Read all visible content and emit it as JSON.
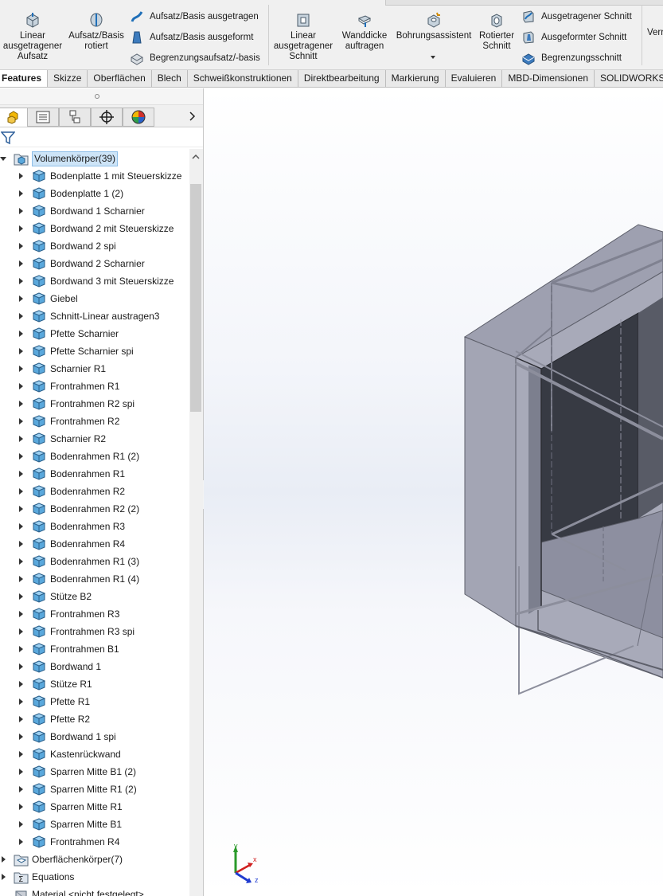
{
  "ribbon": {
    "linear_boss": "Linear ausgetragener Aufsatz",
    "revolved_boss": "Aufsatz/Basis rotiert",
    "swept_boss": "Aufsatz/Basis ausgetragen",
    "lofted_boss": "Aufsatz/Basis ausgeformt",
    "boundary_boss": "Begrenzungsaufsatz/-basis",
    "linear_cut": "Linear ausgetragener Schnitt",
    "thicken": "Wanddicke auftragen",
    "hole_wizard": "Bohrungsassistent",
    "revolved_cut": "Rotierter Schnitt",
    "swept_cut": "Ausgetragener Schnitt",
    "lofted_cut": "Ausgeformter Schnitt",
    "boundary_cut": "Begrenzungsschnitt",
    "more": "Verr"
  },
  "command_tabs": [
    "Features",
    "Skizze",
    "Oberflächen",
    "Blech",
    "Schweißkonstruktionen",
    "Direktbearbeitung",
    "Markierung",
    "Evaluieren",
    "MBD-Dimensionen",
    "SOLIDWORKS"
  ],
  "tree": {
    "root": "Volumenkörper(39)",
    "bodies": [
      "Bodenplatte 1 mit Steuerskizze",
      "Bodenplatte 1 (2)",
      "Bordwand 1 Scharnier",
      "Bordwand 2 mit Steuerskizze",
      "Bordwand 2 spi",
      "Bordwand 2 Scharnier",
      "Bordwand 3 mit Steuerskizze",
      "Giebel",
      "Schnitt-Linear austragen3",
      "Pfette Scharnier",
      "Pfette Scharnier spi",
      "Scharnier R1",
      "Frontrahmen R1",
      "Frontrahmen R2 spi",
      "Frontrahmen R2",
      "Scharnier R2",
      "Bodenrahmen R1 (2)",
      "Bodenrahmen R1",
      "Bodenrahmen R2",
      "Bodenrahmen R2 (2)",
      "Bodenrahmen R3",
      "Bodenrahmen R4",
      "Bodenrahmen R1 (3)",
      "Bodenrahmen R1 (4)",
      "Stütze B2",
      "Frontrahmen R3",
      "Frontrahmen R3 spi",
      "Frontrahmen B1",
      "Bordwand 1",
      "Stütze R1",
      "Pfette R1",
      "Pfette R2",
      "Bordwand 1 spi",
      "Kastenrückwand",
      "Sparren Mitte B1 (2)",
      "Sparren Mitte R1 (2)",
      "Sparren Mitte R1",
      "Sparren Mitte B1",
      "Frontrahmen R4"
    ],
    "surface_bodies": "Oberflächenkörper(7)",
    "equations": "Equations",
    "material": "Material <nicht festgelegt>"
  },
  "triad": {
    "x": "x",
    "y": "y",
    "z": "z"
  },
  "colors": {
    "selection": "#cde4f7",
    "body_icon": "#5aa8dc",
    "model_face": "#a3a5b4",
    "model_inner": "#373a43"
  }
}
